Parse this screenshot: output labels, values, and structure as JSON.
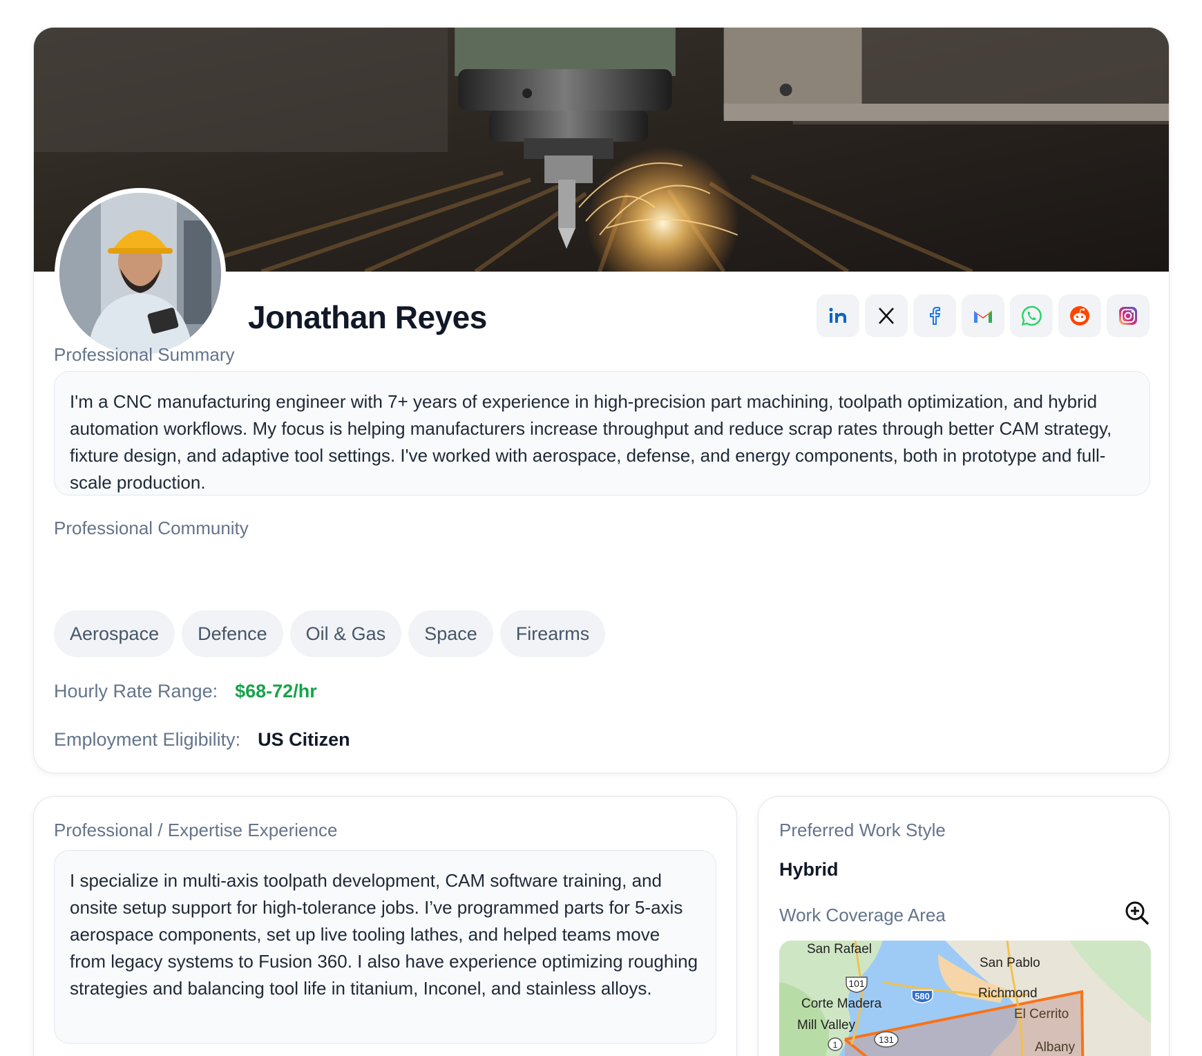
{
  "profile": {
    "name": "Jonathan Reyes",
    "socials": [
      {
        "label": "LinkedIn",
        "icon": "linkedin-icon",
        "color": "#0a66c2"
      },
      {
        "label": "X",
        "icon": "x-icon",
        "color": "#111111"
      },
      {
        "label": "Facebook",
        "icon": "facebook-icon",
        "color": "#1877f2"
      },
      {
        "label": "Gmail",
        "icon": "gmail-icon",
        "color": "#ea4335"
      },
      {
        "label": "WhatsApp",
        "icon": "whatsapp-icon",
        "color": "#25d366"
      },
      {
        "label": "Reddit",
        "icon": "reddit-icon",
        "color": "#ff4500"
      },
      {
        "label": "Instagram",
        "icon": "instagram-icon",
        "color": "#e1306c"
      }
    ],
    "summary_label": "Professional Summary",
    "summary": "I'm a CNC manufacturing engineer with 7+ years of experience in high-precision part machining, toolpath optimization, and hybrid automation workflows. My focus is helping manufacturers increase throughput and reduce scrap rates through better CAM strategy, fixture design, and adaptive tool settings. I've worked with aerospace, defense, and energy components, both in prototype and full-scale production.",
    "community_label": "Professional Community",
    "communities": [
      "Aerospace",
      "Defence",
      "Oil & Gas",
      "Space",
      "Firearms"
    ],
    "rate_label": "Hourly Rate Range:",
    "rate_value": "$68-72/hr",
    "eligibility_label": "Employment Eligibility:",
    "eligibility_value": "US Citizen"
  },
  "experience": {
    "label": "Professional / Expertise Experience",
    "text": "I specialize in multi-axis toolpath development, CAM software training, and onsite setup support for high-tolerance jobs. I’ve programmed parts for 5-axis aerospace components, set up live tooling lathes, and helped teams move from legacy systems to Fusion 360. I also have experience optimizing roughing strategies and balancing tool life in titanium, Inconel, and stainless alloys."
  },
  "workstyle": {
    "label": "Preferred Work Style",
    "value": "Hybrid",
    "coverage_label": "Work Coverage Area",
    "map_labels": {
      "san_rafael": "San Rafael",
      "san_pablo": "San Pablo",
      "richmond": "Richmond",
      "corte_madera": "Corte Madera",
      "mill_valley": "Mill Valley",
      "el_cerrito": "El Cerrito",
      "albany": "Albany",
      "hwy_101": "101",
      "hwy_580": "580",
      "hwy_131": "131",
      "hwy_1": "1"
    }
  },
  "colors": {
    "accent_green": "#16a34a",
    "coverage_outline": "#f97316",
    "label_gray": "#64748b"
  }
}
